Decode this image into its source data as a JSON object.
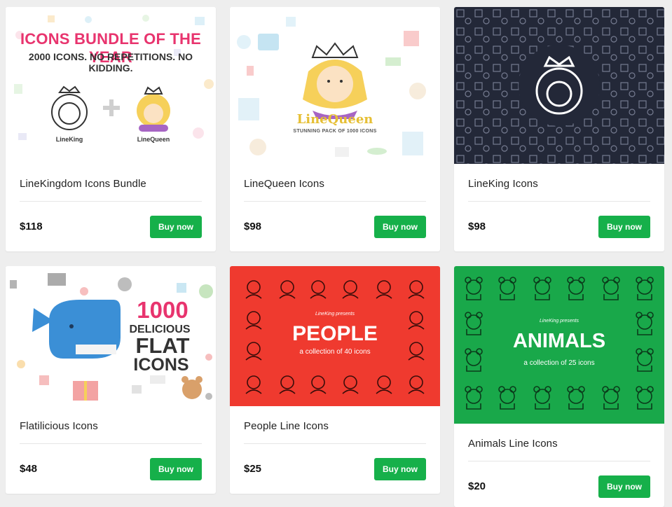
{
  "products": [
    {
      "title": "LineKingdom Icons Bundle",
      "price": "$118",
      "buy_label": "Buy now",
      "thumb": {
        "headline": "ICONS BUNDLE OF THE YEAR",
        "subline": "2000 ICONS. NO REPETITIONS. NO KIDDING.",
        "left_label": "LineKing",
        "right_label": "LineQueen",
        "plus": "+"
      }
    },
    {
      "title": "LineQueen Icons",
      "price": "$98",
      "buy_label": "Buy now",
      "thumb": {
        "brand": "LineQueen",
        "tagline": "STUNNING PACK OF 1000 ICONS"
      }
    },
    {
      "title": "LineKing Icons",
      "price": "$98",
      "buy_label": "Buy now",
      "thumb": {}
    },
    {
      "title": "Flatilicious Icons",
      "price": "$48",
      "buy_label": "Buy now",
      "thumb": {
        "line1": "1000",
        "line2": "DELICIOUS",
        "line3": "FLAT",
        "line4": "ICONS"
      }
    },
    {
      "title": "People Line Icons",
      "price": "$25",
      "buy_label": "Buy now",
      "thumb": {
        "presents": "LineKing presents",
        "headline": "PEOPLE",
        "sub": "a collection of 40 icons"
      }
    },
    {
      "title": "Animals Line Icons",
      "price": "$20",
      "buy_label": "Buy now",
      "thumb": {
        "presents": "LineKing presents",
        "headline": "ANIMALS",
        "sub": "a collection of 25 icons"
      }
    }
  ],
  "colors": {
    "buy_button": "#16b04a",
    "people_bg": "#ef3a2f",
    "animals_bg": "#19a84a",
    "lineking_bg": "#232838",
    "bundle_headline": "#e8346e"
  }
}
